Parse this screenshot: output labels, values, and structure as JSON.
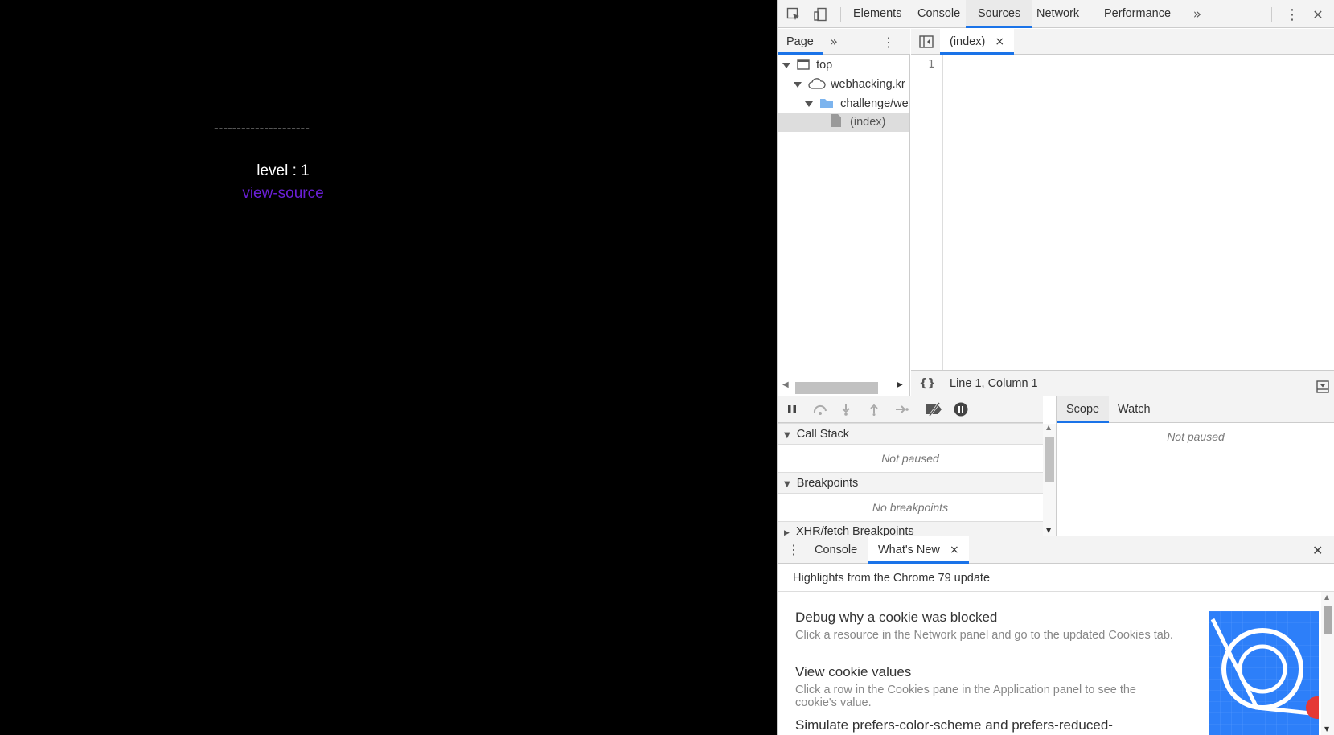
{
  "page": {
    "dashes": "---------------------",
    "level_text": "level : 1",
    "view_source_link": "view-source"
  },
  "devtools": {
    "toolbar": {
      "tabs": [
        "Elements",
        "Console",
        "Sources",
        "Network",
        "Performance"
      ],
      "active_tab": "Sources",
      "more_tabs_glyph": "»",
      "menu_glyph": "⋮",
      "close_glyph": "✕"
    },
    "navigator": {
      "tab_label": "Page",
      "more_glyph": "»",
      "tree": [
        {
          "label": "top",
          "icon": "frame-icon"
        },
        {
          "label": "webhacking.kr",
          "icon": "cloud-icon"
        },
        {
          "label": "challenge/we",
          "icon": "folder-icon"
        },
        {
          "label": "(index)",
          "icon": "file-icon"
        }
      ]
    },
    "editor": {
      "tab_label": "(index)",
      "tab_close": "×",
      "line_number": "1",
      "pretty_print_glyph": "{}",
      "status_text": "Line 1, Column 1"
    },
    "debugger": {
      "call_stack_label": "Call Stack",
      "call_stack_body": "Not paused",
      "breakpoints_label": "Breakpoints",
      "breakpoints_body": "No breakpoints",
      "xhr_label": "XHR/fetch Breakpoints",
      "scope_tab": "Scope",
      "watch_tab": "Watch",
      "scope_body": "Not paused"
    },
    "drawer": {
      "console_tab": "Console",
      "whats_new_tab": "What's New",
      "tab_close": "×",
      "close_glyph": "✕",
      "subtitle": "Highlights from the Chrome 79 update",
      "items": [
        {
          "title": "Debug why a cookie was blocked",
          "body": "Click a resource in the Network panel and go to the updated Cookies tab."
        },
        {
          "title": "View cookie values",
          "body": "Click a row in the Cookies pane in the Application panel to see the cookie's value."
        },
        {
          "title": "Simulate prefers-color-scheme and prefers-reduced-",
          "body": ""
        }
      ]
    },
    "colors": {
      "accent": "#1a73e8",
      "link": "#6a1fd6",
      "promo": "#2d7ff9"
    }
  }
}
